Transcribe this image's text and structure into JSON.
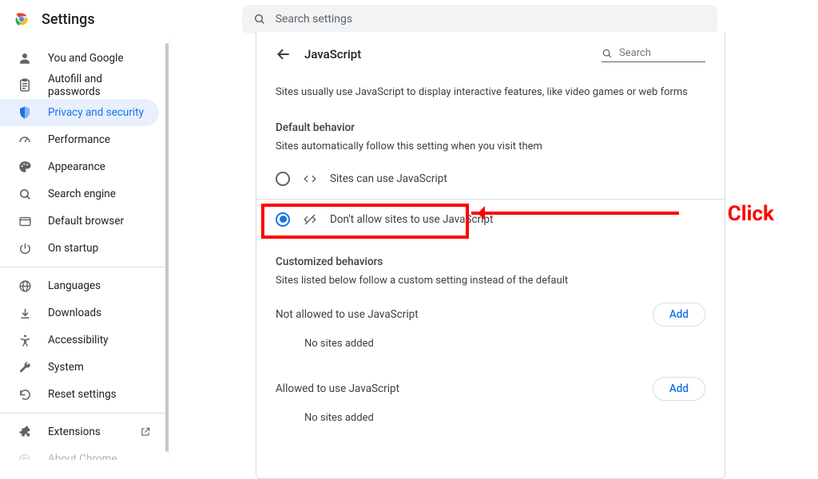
{
  "app": {
    "title": "Settings",
    "search_placeholder": "Search settings"
  },
  "sidebar": {
    "items": [
      {
        "label": "You and Google",
        "icon": "person-icon"
      },
      {
        "label": "Autofill and passwords",
        "icon": "autofill-icon"
      },
      {
        "label": "Privacy and security",
        "icon": "shield-icon",
        "active": true
      },
      {
        "label": "Performance",
        "icon": "speedometer-icon"
      },
      {
        "label": "Appearance",
        "icon": "palette-icon"
      },
      {
        "label": "Search engine",
        "icon": "search-icon"
      },
      {
        "label": "Default browser",
        "icon": "window-icon"
      },
      {
        "label": "On startup",
        "icon": "power-icon"
      }
    ],
    "secondary": [
      {
        "label": "Languages",
        "icon": "globe-icon"
      },
      {
        "label": "Downloads",
        "icon": "download-icon"
      },
      {
        "label": "Accessibility",
        "icon": "accessibility-icon"
      },
      {
        "label": "System",
        "icon": "wrench-icon"
      },
      {
        "label": "Reset settings",
        "icon": "reset-icon"
      }
    ],
    "footer": [
      {
        "label": "Extensions",
        "icon": "puzzle-icon",
        "external": true
      },
      {
        "label": "About Chrome",
        "icon": "chrome-icon"
      }
    ]
  },
  "page": {
    "title": "JavaScript",
    "search_placeholder": "Search",
    "intro": "Sites usually use JavaScript to display interactive features, like video games or web forms",
    "default_behavior_title": "Default behavior",
    "default_behavior_sub": "Sites automatically follow this setting when you visit them",
    "option_allow": "Sites can use JavaScript",
    "option_block": "Don't allow sites to use JavaScript",
    "customized_title": "Customized behaviors",
    "customized_sub": "Sites listed below follow a custom setting instead of the default",
    "not_allowed_label": "Not allowed to use JavaScript",
    "allowed_label": "Allowed to use JavaScript",
    "add_label": "Add",
    "empty_label": "No sites added"
  },
  "annotation": {
    "label": "Click"
  }
}
